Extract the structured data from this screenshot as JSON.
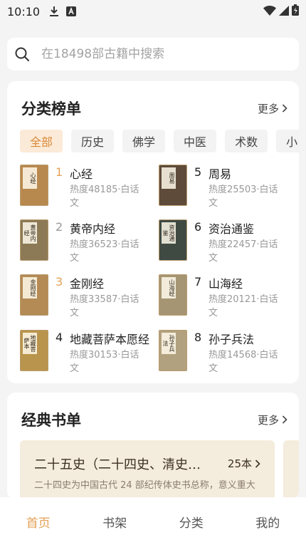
{
  "status": {
    "time": "10:10",
    "icons": [
      "download-icon",
      "a-badge-icon",
      "wifi-icon",
      "signal-icon",
      "battery-icon"
    ]
  },
  "search": {
    "placeholder": "在18498部古籍中搜索"
  },
  "ranking": {
    "title": "分类榜单",
    "more": "更多",
    "categories": [
      "全部",
      "历史",
      "佛学",
      "中医",
      "术数",
      "小"
    ],
    "selected_category": "全部",
    "items": [
      {
        "rank": "1",
        "title": "心经",
        "meta": "热度48185·白话文",
        "cover_label": "心经",
        "cover_color": "#b8894e"
      },
      {
        "rank": "2",
        "title": "黄帝内经",
        "meta": "热度36523·白话文",
        "cover_label": "黄帝内经",
        "cover_color": "#8c7a56"
      },
      {
        "rank": "3",
        "title": "金刚经",
        "meta": "热度33587·白话文",
        "cover_label": "金刚经",
        "cover_color": "#b48a55"
      },
      {
        "rank": "4",
        "title": "地藏菩萨本愿经",
        "meta": "热度30153·白话文",
        "cover_label": "地藏菩萨本",
        "cover_color": "#b9944c"
      },
      {
        "rank": "5",
        "title": "周易",
        "meta": "热度25503·白话文",
        "cover_label": "周易",
        "cover_color": "#5f4b3a"
      },
      {
        "rank": "6",
        "title": "资治通鉴",
        "meta": "热度22457·白话文",
        "cover_label": "资治通鉴",
        "cover_color": "#3f4a43"
      },
      {
        "rank": "7",
        "title": "山海经",
        "meta": "热度20121·白话文",
        "cover_label": "山海经",
        "cover_color": "#a69572"
      },
      {
        "rank": "8",
        "title": "孙子兵法",
        "meta": "热度14568·白话文",
        "cover_label": "孙子兵法",
        "cover_color": "#b2a17e"
      }
    ]
  },
  "classic": {
    "title": "经典书单",
    "more": "更多",
    "list": {
      "name": "二十五史（二十四史、清史稿）",
      "count": "25本",
      "desc": "二十四史为中国古代 24 部纪传体史书总称，意义重大"
    }
  },
  "tabs": [
    {
      "label": "首页",
      "active": true
    },
    {
      "label": "书架",
      "active": false
    },
    {
      "label": "分类",
      "active": false
    },
    {
      "label": "我的",
      "active": false
    }
  ],
  "colors": {
    "accent": "#e3a055",
    "chip_active_bg": "#fbead7",
    "banner_bg": "#f4ecdd"
  }
}
